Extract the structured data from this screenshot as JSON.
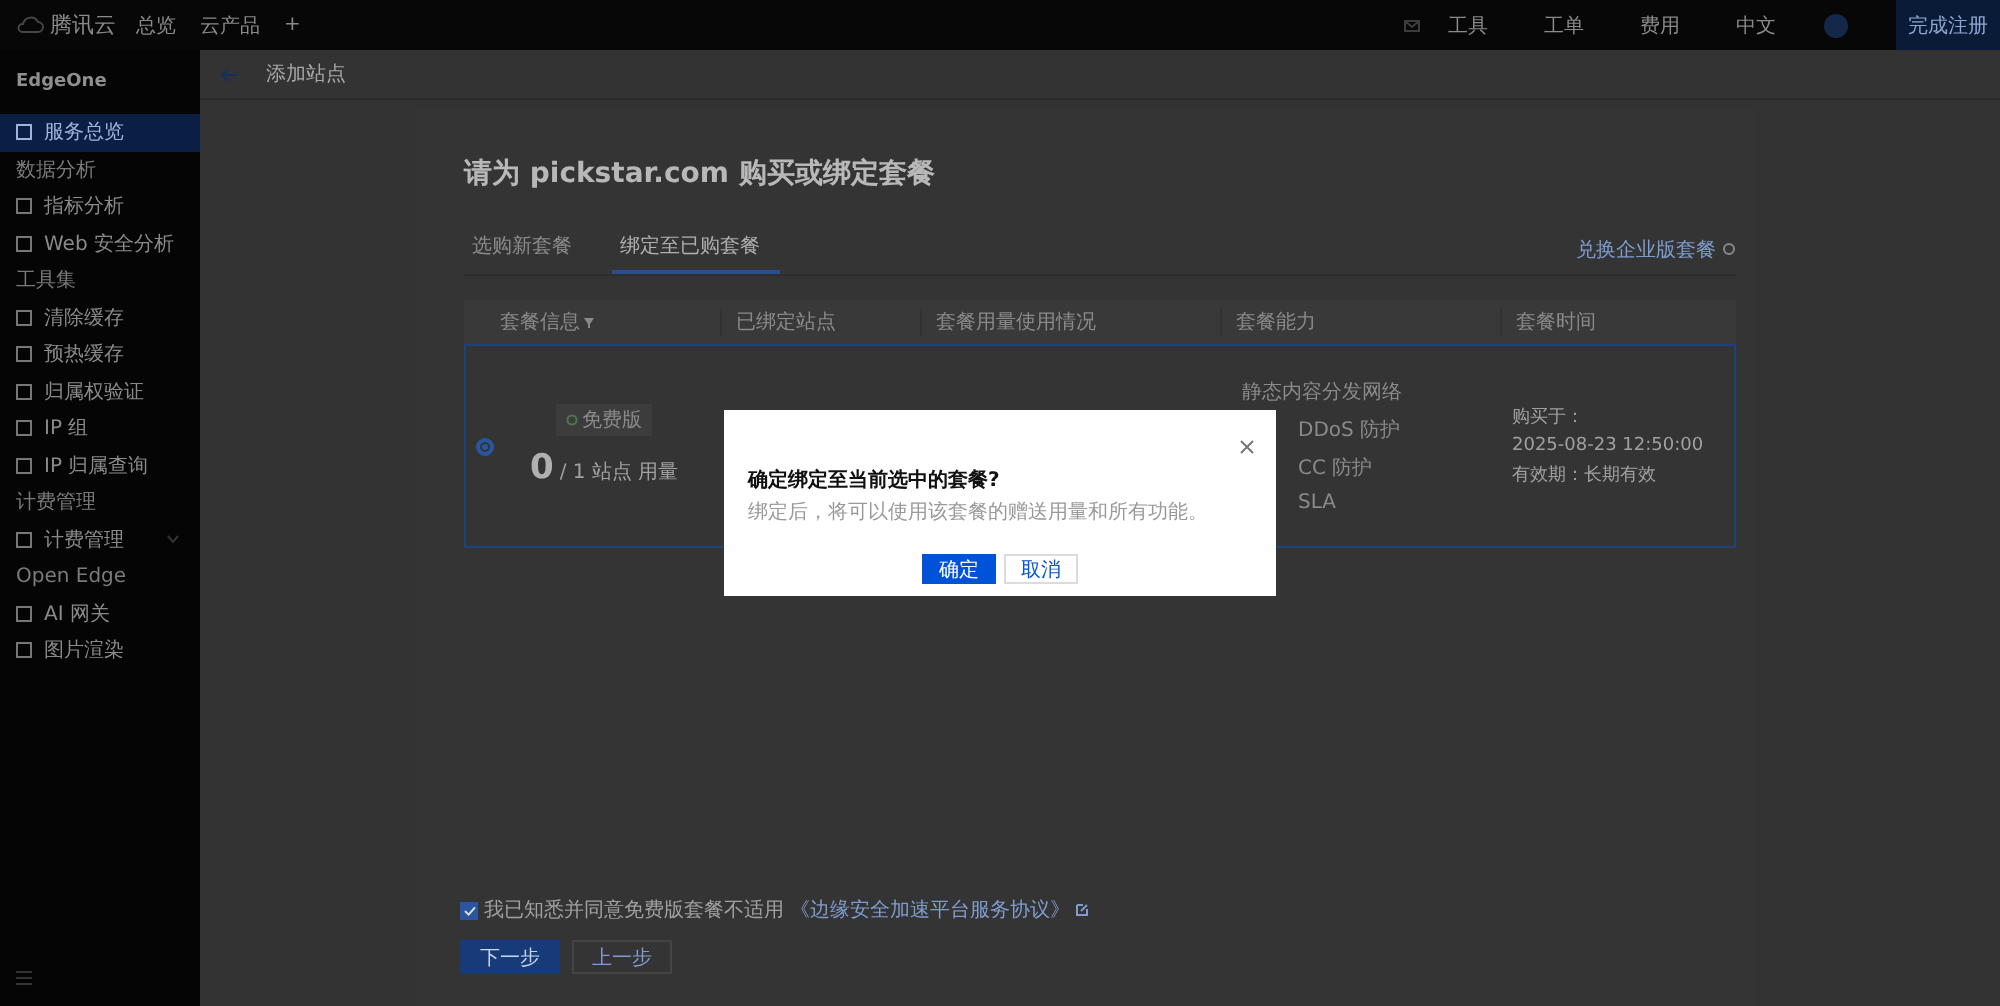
{
  "topbar": {
    "logo": "腾讯云",
    "nav": [
      "总览",
      "云产品",
      "+"
    ],
    "links": [
      "工具",
      "工单",
      "费用",
      "中文"
    ],
    "register": "完成注册"
  },
  "sidebar": {
    "product": "EdgeOne",
    "items": [
      {
        "kind": "item",
        "label": "服务总览",
        "selected": true
      },
      {
        "kind": "group",
        "label": "数据分析"
      },
      {
        "kind": "item",
        "label": "指标分析",
        "selected": false
      },
      {
        "kind": "item",
        "label": "Web 安全分析",
        "selected": false
      },
      {
        "kind": "group",
        "label": "工具集"
      },
      {
        "kind": "item",
        "label": "清除缓存",
        "selected": false
      },
      {
        "kind": "item",
        "label": "预热缓存",
        "selected": false
      },
      {
        "kind": "item",
        "label": "归属权验证",
        "selected": false
      },
      {
        "kind": "item",
        "label": "IP 组",
        "selected": false
      },
      {
        "kind": "item",
        "label": "IP 归属查询",
        "selected": false
      },
      {
        "kind": "group",
        "label": "计费管理"
      },
      {
        "kind": "item",
        "label": "计费管理",
        "selected": false,
        "expanded": false
      },
      {
        "kind": "group",
        "label": "Open Edge"
      },
      {
        "kind": "item",
        "label": "AI 网关",
        "selected": false
      },
      {
        "kind": "item",
        "label": "图片渲染",
        "selected": false
      }
    ]
  },
  "header": {
    "title": "添加站点"
  },
  "page": {
    "title": "请为 pickstar.com 购买或绑定套餐",
    "tabs": [
      {
        "label": "选购新套餐",
        "selected": false
      },
      {
        "label": "绑定至已购套餐",
        "selected": true
      }
    ],
    "redeem_link": "兑换企业版套餐",
    "table": {
      "columns": [
        "套餐信息",
        "已绑定站点",
        "套餐用量使用情况",
        "套餐能力",
        "套餐时间"
      ],
      "rows": [
        {
          "selected": true,
          "badge": "免费版",
          "count": "0",
          "quota": "/ 1 站点 用量",
          "features": [
            "静态内容分发网络",
            "DDoS 防护",
            "CC 防护",
            "SLA"
          ],
          "purchased_label": "购买于：",
          "purchased_at": "2025-08-23 12:50:00",
          "validity": "有效期：长期有效"
        }
      ]
    },
    "agreement": {
      "checked": true,
      "text": "我已知悉并同意免费版套餐不适用",
      "link": "《边缘安全加速平台服务协议》"
    },
    "next": "下一步",
    "prev": "上一步"
  },
  "dialog": {
    "title": "确定绑定至当前选中的套餐?",
    "body": "绑定后，将可以使用该套餐的赠送用量和所有功能。",
    "confirm": "确定",
    "cancel": "取消"
  }
}
